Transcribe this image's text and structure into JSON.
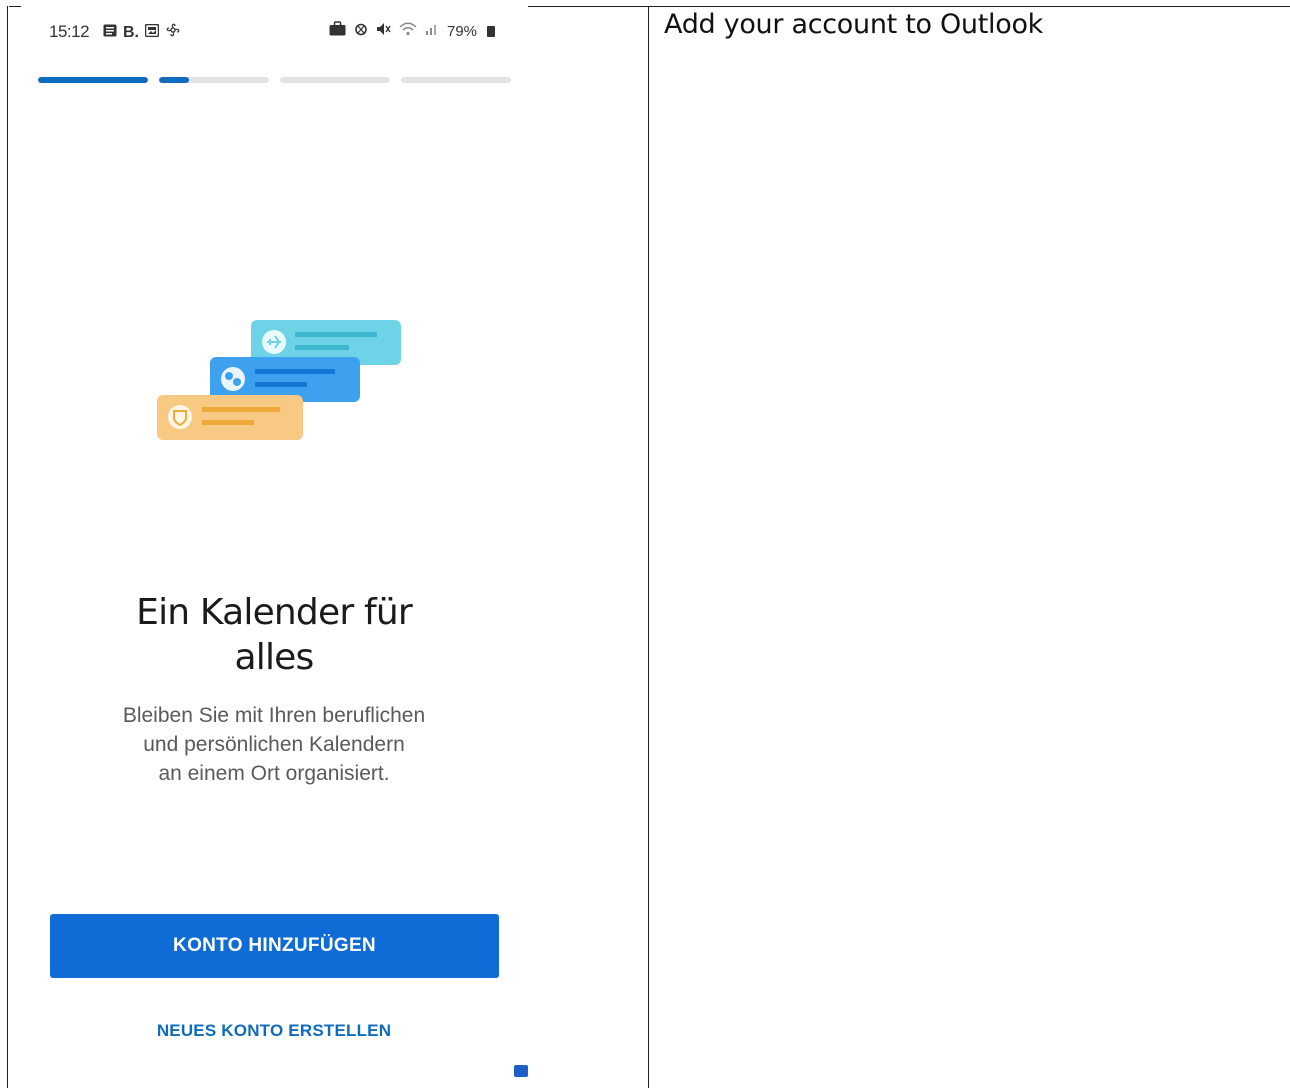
{
  "document": {
    "caption": "Add your account to Outlook"
  },
  "statusbar": {
    "time": "15:12",
    "left_icons": [
      "notes-icon",
      "b-app-icon",
      "image-icon",
      "fan-icon"
    ],
    "left_b": "B.",
    "right_icons": [
      "briefcase-icon",
      "alarm-icon",
      "mute-icon",
      "wifi-icon",
      "signal-icon"
    ],
    "battery": "79%"
  },
  "onboarding": {
    "progress_steps": [
      1.0,
      0.27,
      0.0,
      0.0
    ],
    "illustration_cards": [
      {
        "icon": "airplane-icon",
        "color": "#6fd3e8"
      },
      {
        "icon": "chat-icon",
        "color": "#3ea1f0"
      },
      {
        "icon": "shield-icon",
        "color": "#f8c982"
      }
    ],
    "title": "Ein Kalender für alles",
    "subtitle_lines": [
      "Bleiben Sie mit Ihren beruflichen",
      "und persönlichen Kalendern",
      "an einem Ort organisiert."
    ],
    "primary_button": "KONTO HINZUFÜGEN",
    "secondary_link": "NEUES KONTO ERSTELLEN"
  },
  "colors": {
    "accent": "#0f6cbd",
    "button": "#0f6cd6",
    "progress_track": "#e3e3e3"
  }
}
